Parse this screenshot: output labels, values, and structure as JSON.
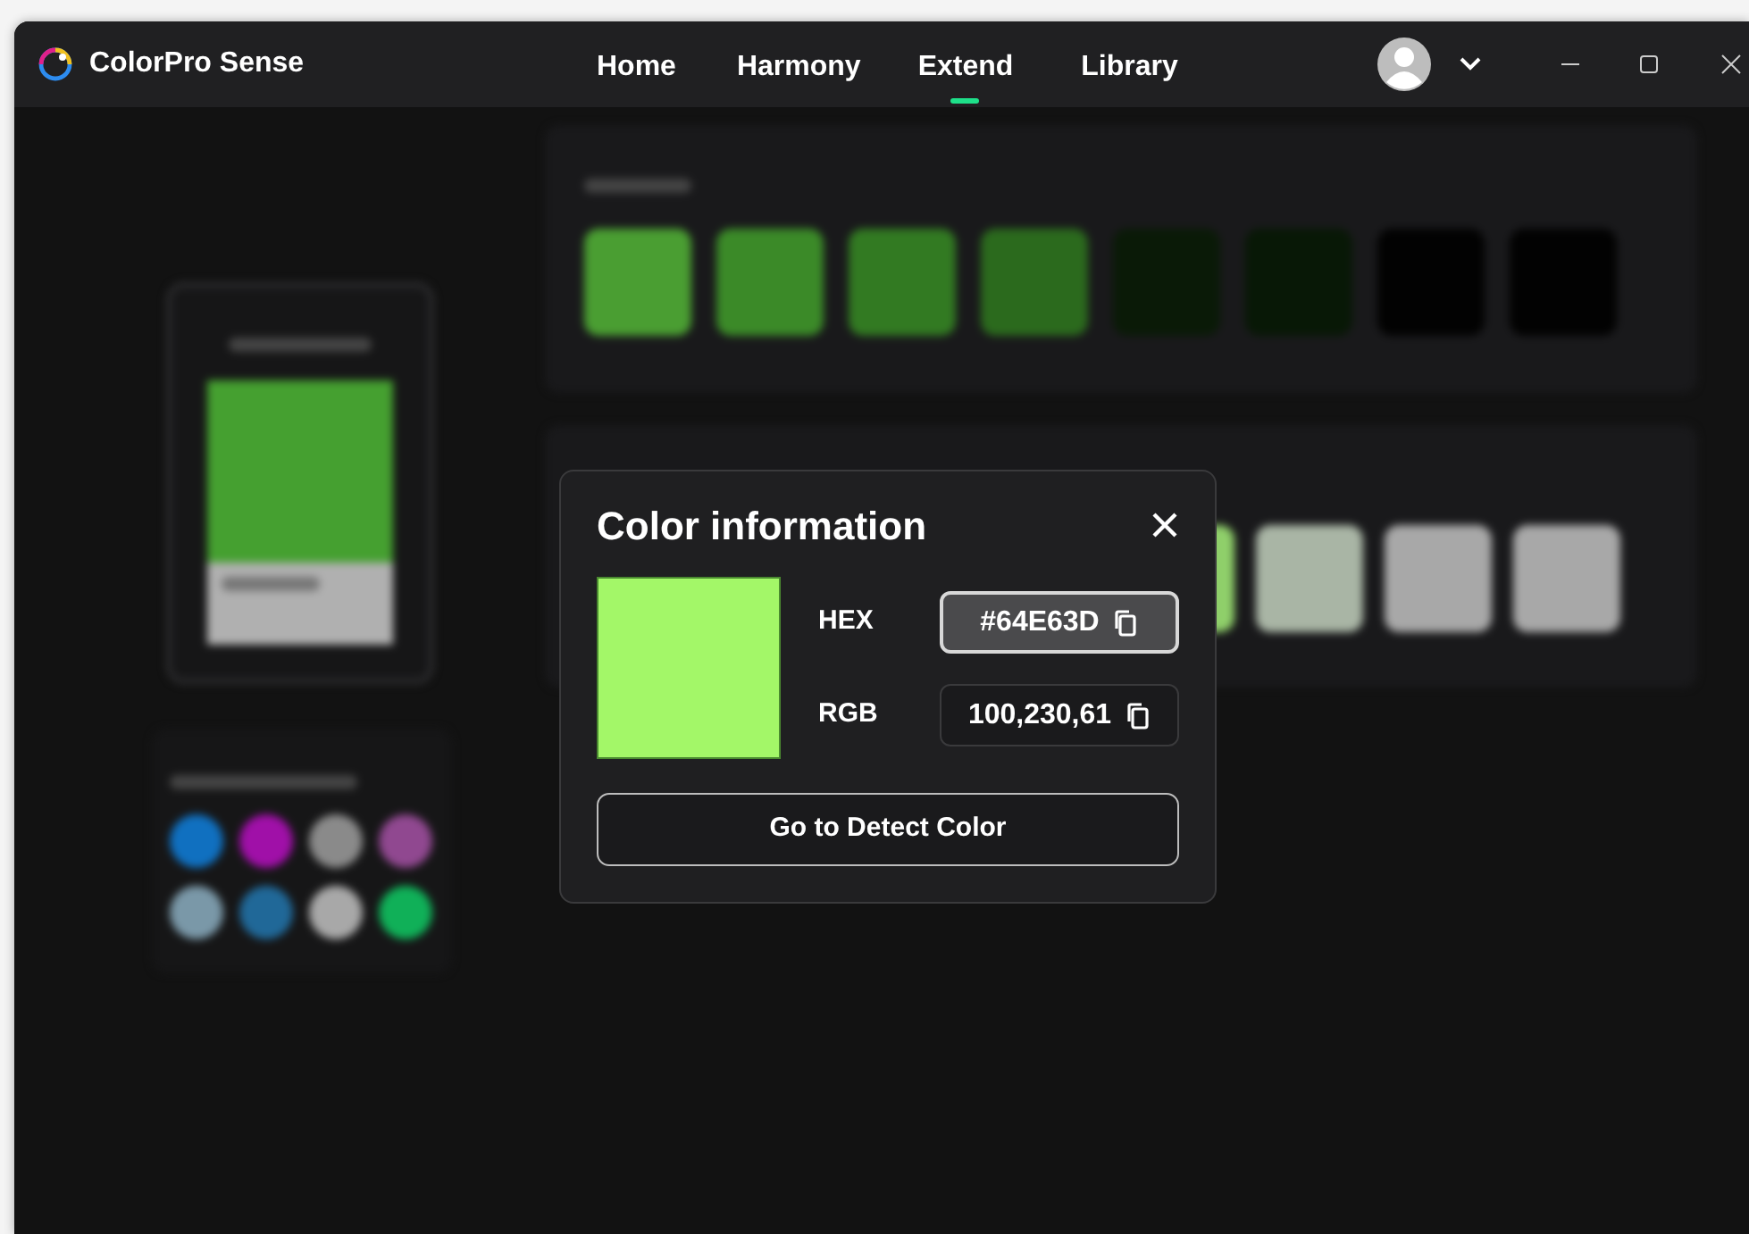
{
  "app": {
    "title": "ColorPro Sense"
  },
  "nav": [
    {
      "label": "Home",
      "selected": false
    },
    {
      "label": "Harmony",
      "selected": false
    },
    {
      "label": "Extend",
      "selected": true
    },
    {
      "label": "Library",
      "selected": false
    }
  ],
  "background": {
    "main_color": {
      "color": "#45a030"
    },
    "shades": [
      {
        "color": "#4a9e32"
      },
      {
        "color": "#3b8a28"
      },
      {
        "color": "#327a22"
      },
      {
        "color": "#2b6a1d"
      },
      {
        "color": "#0a1a07"
      },
      {
        "color": "#081806"
      },
      {
        "color": "#020202"
      },
      {
        "color": "#020202"
      }
    ],
    "tints": [
      {
        "color": "#8fcf6a"
      },
      {
        "color": "#a9b5a5"
      },
      {
        "color": "#a8a8a8"
      },
      {
        "color": "#a8a8a8"
      }
    ],
    "history": [
      {
        "color": "#1070c0"
      },
      {
        "color": "#a010a8"
      },
      {
        "color": "#8a8a8a"
      },
      {
        "color": "#904890"
      },
      {
        "color": "#7a98a8"
      },
      {
        "color": "#206898"
      },
      {
        "color": "#a8a8a8"
      },
      {
        "color": "#10b058"
      }
    ]
  },
  "dialog": {
    "title": "Color information",
    "color": "#a3f768",
    "fields": [
      {
        "label": "HEX",
        "value": "#64E63D",
        "selected": true
      },
      {
        "label": "RGB",
        "value": "100,230,61",
        "selected": false
      }
    ],
    "button": "Go to Detect Color"
  }
}
